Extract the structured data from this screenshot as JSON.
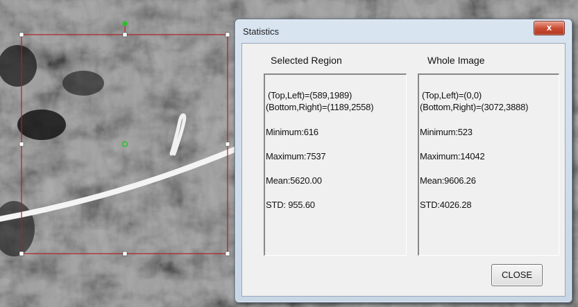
{
  "dialog": {
    "title": "Statistics",
    "close_icon_glyph": "x",
    "selected_region": {
      "header": "Selected Region",
      "top_left": "(Top,Left)=(589,1989)",
      "bottom_right": "(Bottom,Right)=(1189,2558)",
      "minimum": "Minimum:616",
      "maximum": "Maximum:7537",
      "mean": "Mean:5620.00",
      "std": "STD: 955.60"
    },
    "whole_image": {
      "header": "Whole Image",
      "top_left": "(Top,Left)=(0,0)",
      "bottom_right": "(Bottom,Right)=(3072,3888)",
      "minimum": "Minimum:523",
      "maximum": "Maximum:14042",
      "mean": "Mean:9606.26",
      "std": "STD:4026.28"
    },
    "close_button_label": "CLOSE"
  },
  "colors": {
    "selection_frame": "#b02020",
    "handle": "#ffffff",
    "center_handle": "#27c227"
  }
}
